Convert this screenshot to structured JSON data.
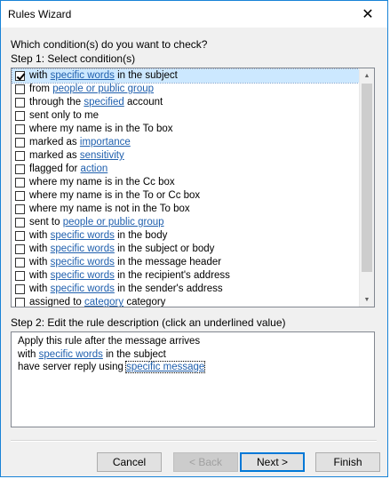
{
  "window": {
    "title": "Rules Wizard",
    "close_glyph": "✕"
  },
  "question": "Which condition(s) do you want to check?",
  "step1_label": "Step 1: Select condition(s)",
  "conditions": [
    {
      "checked": true,
      "selected": true,
      "parts": [
        [
          "with ",
          false
        ],
        [
          "specific words",
          true
        ],
        [
          " in the subject",
          false
        ]
      ]
    },
    {
      "checked": false,
      "selected": false,
      "parts": [
        [
          "from ",
          false
        ],
        [
          "people or public group",
          true
        ]
      ]
    },
    {
      "checked": false,
      "selected": false,
      "parts": [
        [
          "through the ",
          false
        ],
        [
          "specified",
          true
        ],
        [
          " account",
          false
        ]
      ]
    },
    {
      "checked": false,
      "selected": false,
      "parts": [
        [
          "sent only to me",
          false
        ]
      ]
    },
    {
      "checked": false,
      "selected": false,
      "parts": [
        [
          "where my name is in the To box",
          false
        ]
      ]
    },
    {
      "checked": false,
      "selected": false,
      "parts": [
        [
          "marked as ",
          false
        ],
        [
          "importance",
          true
        ]
      ]
    },
    {
      "checked": false,
      "selected": false,
      "parts": [
        [
          "marked as ",
          false
        ],
        [
          "sensitivity",
          true
        ]
      ]
    },
    {
      "checked": false,
      "selected": false,
      "parts": [
        [
          "flagged for ",
          false
        ],
        [
          "action",
          true
        ]
      ]
    },
    {
      "checked": false,
      "selected": false,
      "parts": [
        [
          "where my name is in the Cc box",
          false
        ]
      ]
    },
    {
      "checked": false,
      "selected": false,
      "parts": [
        [
          "where my name is in the To or Cc box",
          false
        ]
      ]
    },
    {
      "checked": false,
      "selected": false,
      "parts": [
        [
          "where my name is not in the To box",
          false
        ]
      ]
    },
    {
      "checked": false,
      "selected": false,
      "parts": [
        [
          "sent to ",
          false
        ],
        [
          "people or public group",
          true
        ]
      ]
    },
    {
      "checked": false,
      "selected": false,
      "parts": [
        [
          "with ",
          false
        ],
        [
          "specific words",
          true
        ],
        [
          " in the body",
          false
        ]
      ]
    },
    {
      "checked": false,
      "selected": false,
      "parts": [
        [
          "with ",
          false
        ],
        [
          "specific words",
          true
        ],
        [
          " in the subject or body",
          false
        ]
      ]
    },
    {
      "checked": false,
      "selected": false,
      "parts": [
        [
          "with ",
          false
        ],
        [
          "specific words",
          true
        ],
        [
          " in the message header",
          false
        ]
      ]
    },
    {
      "checked": false,
      "selected": false,
      "parts": [
        [
          "with ",
          false
        ],
        [
          "specific words",
          true
        ],
        [
          " in the recipient's address",
          false
        ]
      ]
    },
    {
      "checked": false,
      "selected": false,
      "parts": [
        [
          "with ",
          false
        ],
        [
          "specific words",
          true
        ],
        [
          " in the sender's address",
          false
        ]
      ]
    },
    {
      "checked": false,
      "selected": false,
      "parts": [
        [
          "assigned to ",
          false
        ],
        [
          "category",
          true
        ],
        [
          " category",
          false
        ]
      ]
    }
  ],
  "scroll": {
    "up_glyph": "▲",
    "down_glyph": "▼"
  },
  "step2_label": "Step 2: Edit the rule description (click an underlined value)",
  "description": {
    "line1": "Apply this rule after the message arrives",
    "line2_prefix": "with ",
    "line2_link": "specific words",
    "line2_suffix": " in the subject",
    "line3_prefix": "have server reply using ",
    "line3_link": "specific message"
  },
  "buttons": {
    "cancel": "Cancel",
    "back": "< Back",
    "next": "Next >",
    "finish": "Finish"
  },
  "colors": {
    "link": "#1f5fad",
    "selection": "#cce8ff",
    "accent": "#0078d7"
  }
}
